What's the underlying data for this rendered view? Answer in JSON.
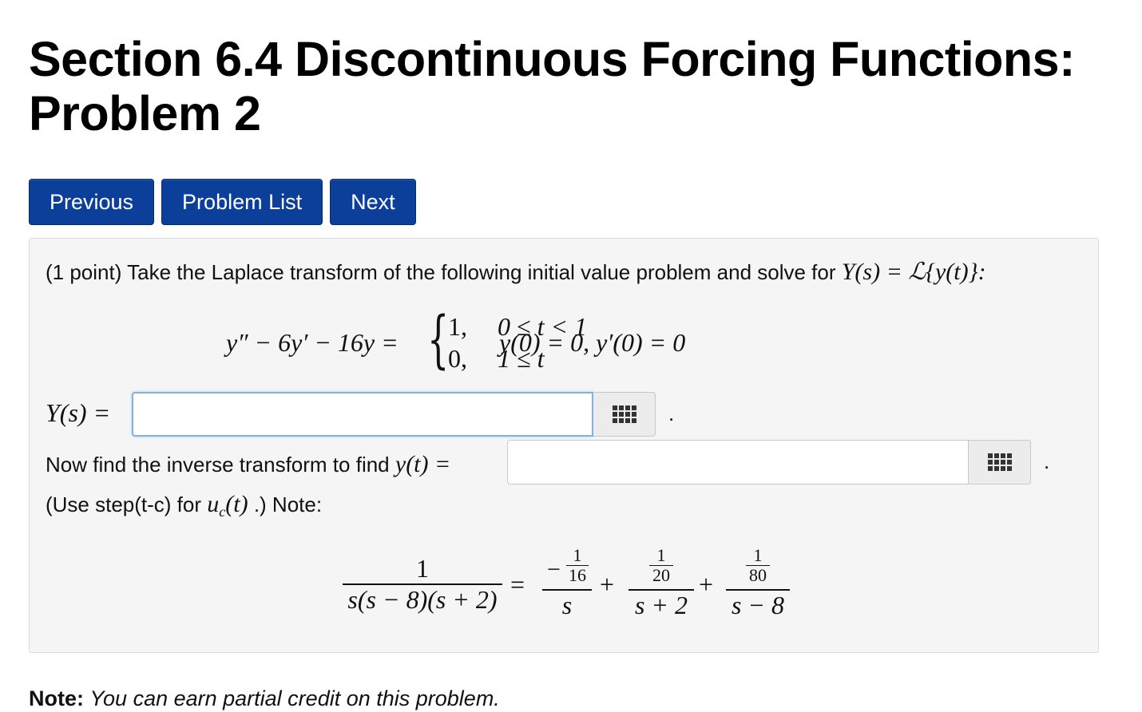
{
  "header": {
    "title": "Section 6.4 Discontinuous Forcing Functions: Problem 2"
  },
  "nav": {
    "previous_label": "Previous",
    "problem_list_label": "Problem List",
    "next_label": "Next"
  },
  "problem": {
    "points_text": "(1 point) Take the Laplace transform of the following initial value problem and solve for",
    "intro_math": "Y(s) = ℒ{y(t)}:",
    "ivp_left": "y″ − 6y′ − 16y =",
    "case1_value": "1,",
    "case1_condition": "0 ≤ t < 1",
    "case2_value": "0,",
    "case2_condition": "1 ≤ t",
    "initial_conditions": "y(0) = 0,  y′(0) = 0",
    "answer1_label": "Y(s) =",
    "answer1_value": "",
    "answer1_period": ".",
    "inverse_text": "Now find the inverse transform to find",
    "inverse_math": "y(t) =",
    "answer2_value": "",
    "answer2_period": ".",
    "use_step_text_1": "(Use step(t-c) for",
    "use_step_math": "u",
    "use_step_sub": "c",
    "use_step_math_2": "(t)",
    "use_step_text_2": ".) Note:"
  },
  "partial_fraction": {
    "lhs_num": "1",
    "lhs_den": "s(s − 8)(s + 2)",
    "eq": "=",
    "t1_neg": "−",
    "t1_inner_num": "1",
    "t1_inner_den": "16",
    "t1_den": "s",
    "plus1": "+",
    "t2_inner_num": "1",
    "t2_inner_den": "20",
    "t2_den": "s + 2",
    "plus2": "+",
    "t3_inner_num": "1",
    "t3_inner_den": "80",
    "t3_den": "s − 8"
  },
  "footer": {
    "note_label": "Note:",
    "note_text": "You can earn partial credit on this problem."
  },
  "icons": {
    "equation_editor": "grid-icon"
  },
  "colors": {
    "button_bg": "#0b3f9a",
    "panel_bg": "#f5f5f5",
    "focus_border": "#7fb3e6"
  }
}
